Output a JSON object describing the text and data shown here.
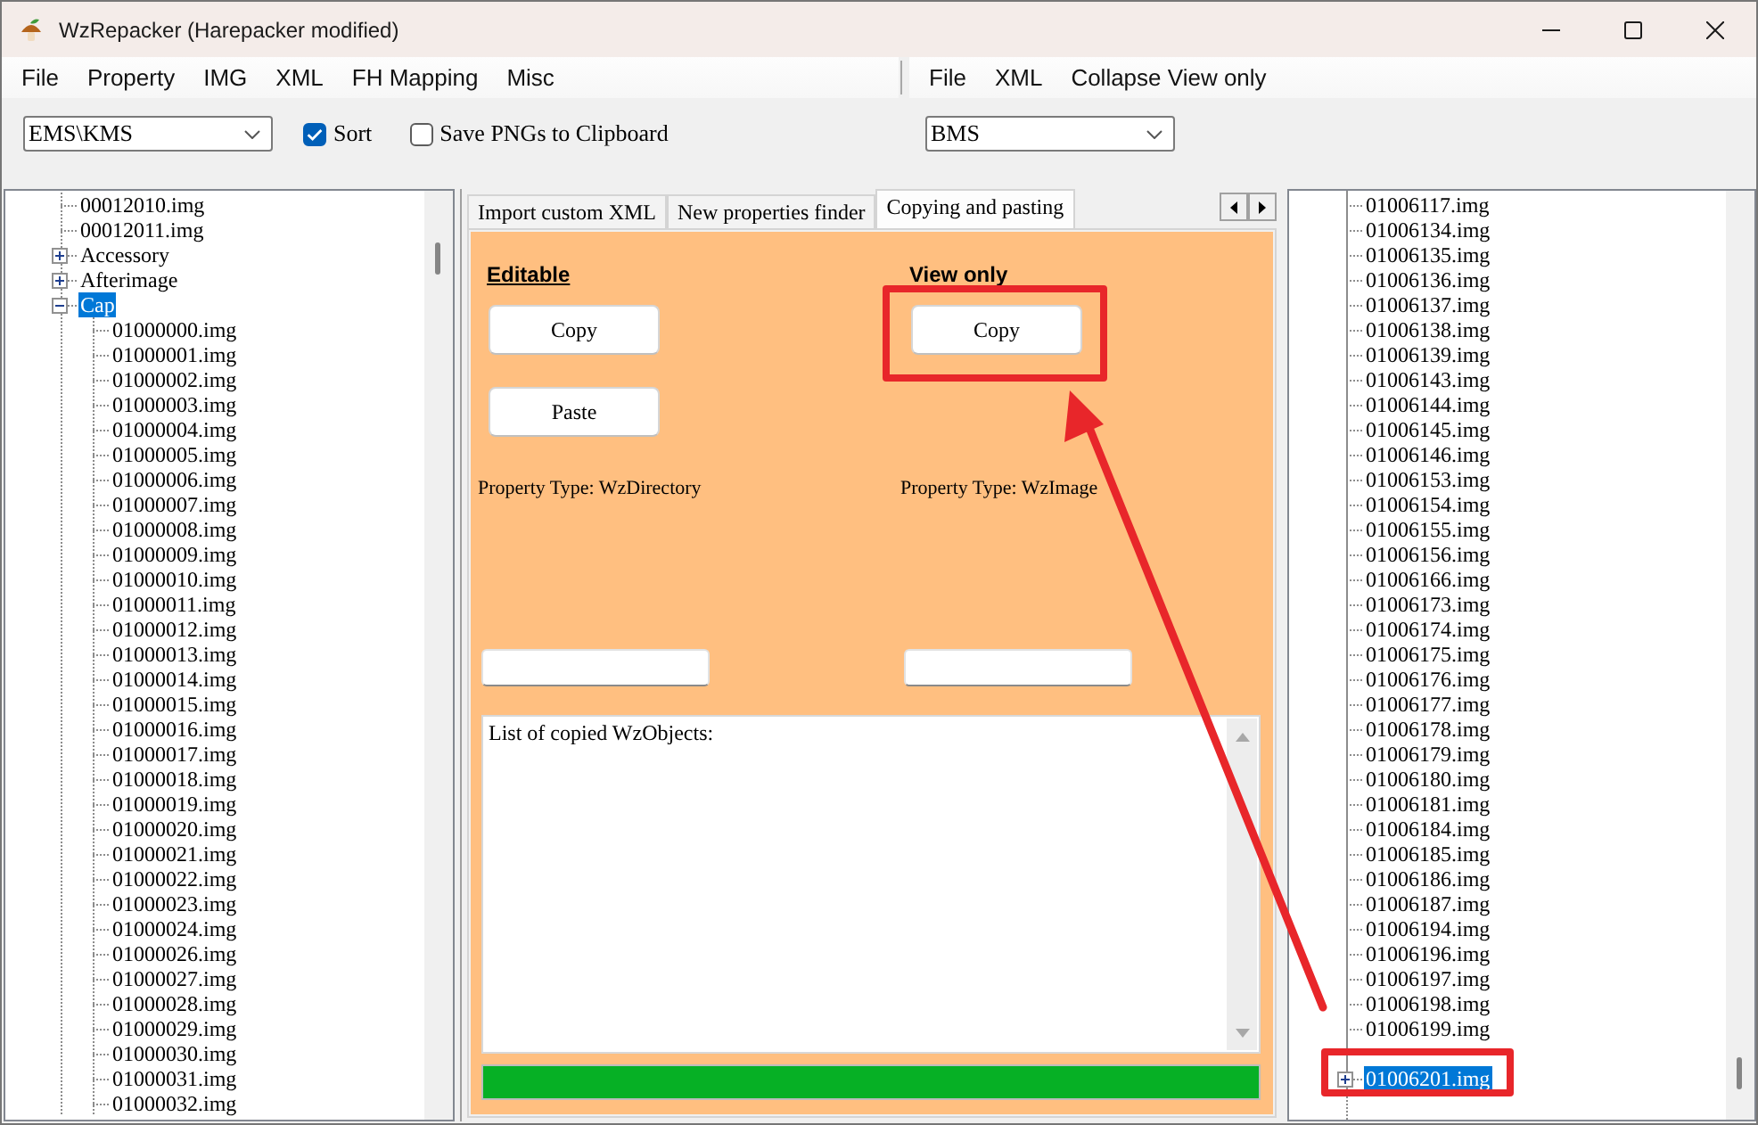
{
  "window": {
    "title": "WzRepacker (Harepacker modified)"
  },
  "menu_left": [
    "File",
    "Property",
    "IMG",
    "XML",
    "FH Mapping",
    "Misc"
  ],
  "menu_right": [
    "File",
    "XML",
    "Collapse View only"
  ],
  "toolbar_left": {
    "version_select": "EMS\\KMS",
    "checkboxes": [
      {
        "label": "Sort",
        "checked": true
      },
      {
        "label": "Save PNGs to Clipboard",
        "checked": false
      }
    ]
  },
  "toolbar_right": {
    "version_select": "BMS"
  },
  "left_tree": {
    "items": [
      {
        "label": "00012010.img",
        "kind": "leaf",
        "selected": false
      },
      {
        "label": "00012011.img",
        "kind": "leaf",
        "selected": false
      },
      {
        "label": "Accessory",
        "kind": "branch",
        "expanded": false,
        "selected": false
      },
      {
        "label": "Afterimage",
        "kind": "branch",
        "expanded": false,
        "selected": false
      },
      {
        "label": "Cap",
        "kind": "branch",
        "expanded": true,
        "selected": true,
        "children": [
          {
            "label": "01000000.img",
            "kind": "leaf",
            "selected": false
          },
          {
            "label": "01000001.img",
            "kind": "leaf",
            "selected": false
          },
          {
            "label": "01000002.img",
            "kind": "leaf",
            "selected": false
          },
          {
            "label": "01000003.img",
            "kind": "leaf",
            "selected": false
          },
          {
            "label": "01000004.img",
            "kind": "leaf",
            "selected": false
          },
          {
            "label": "01000005.img",
            "kind": "leaf",
            "selected": false
          },
          {
            "label": "01000006.img",
            "kind": "leaf",
            "selected": false
          },
          {
            "label": "01000007.img",
            "kind": "leaf",
            "selected": false
          },
          {
            "label": "01000008.img",
            "kind": "leaf",
            "selected": false
          },
          {
            "label": "01000009.img",
            "kind": "leaf",
            "selected": false
          },
          {
            "label": "01000010.img",
            "kind": "leaf",
            "selected": false
          },
          {
            "label": "01000011.img",
            "kind": "leaf",
            "selected": false
          },
          {
            "label": "01000012.img",
            "kind": "leaf",
            "selected": false
          },
          {
            "label": "01000013.img",
            "kind": "leaf",
            "selected": false
          },
          {
            "label": "01000014.img",
            "kind": "leaf",
            "selected": false
          },
          {
            "label": "01000015.img",
            "kind": "leaf",
            "selected": false
          },
          {
            "label": "01000016.img",
            "kind": "leaf",
            "selected": false
          },
          {
            "label": "01000017.img",
            "kind": "leaf",
            "selected": false
          },
          {
            "label": "01000018.img",
            "kind": "leaf",
            "selected": false
          },
          {
            "label": "01000019.img",
            "kind": "leaf",
            "selected": false
          },
          {
            "label": "01000020.img",
            "kind": "leaf",
            "selected": false
          },
          {
            "label": "01000021.img",
            "kind": "leaf",
            "selected": false
          },
          {
            "label": "01000022.img",
            "kind": "leaf",
            "selected": false
          },
          {
            "label": "01000023.img",
            "kind": "leaf",
            "selected": false
          },
          {
            "label": "01000024.img",
            "kind": "leaf",
            "selected": false
          },
          {
            "label": "01000026.img",
            "kind": "leaf",
            "selected": false
          },
          {
            "label": "01000027.img",
            "kind": "leaf",
            "selected": false
          },
          {
            "label": "01000028.img",
            "kind": "leaf",
            "selected": false
          },
          {
            "label": "01000029.img",
            "kind": "leaf",
            "selected": false
          },
          {
            "label": "01000030.img",
            "kind": "leaf",
            "selected": false
          },
          {
            "label": "01000031.img",
            "kind": "leaf",
            "selected": false
          },
          {
            "label": "01000032.img",
            "kind": "leaf",
            "selected": false
          }
        ]
      }
    ]
  },
  "tabs": [
    {
      "label": "Import custom XML",
      "selected": false
    },
    {
      "label": "New properties finder",
      "selected": false
    },
    {
      "label": "Copying and pasting",
      "selected": true
    }
  ],
  "copy_paste": {
    "columns": [
      {
        "heading": "Editable",
        "underlined": true,
        "buttons": [
          {
            "label": "Copy",
            "highlighted": false
          },
          {
            "label": "Paste",
            "highlighted": false
          }
        ],
        "property_type": "Property Type: WzDirectory"
      },
      {
        "heading": "View only",
        "underlined": false,
        "buttons": [
          {
            "label": "Copy",
            "highlighted": true
          }
        ],
        "property_type": "Property Type: WzImage"
      }
    ],
    "copied_list": {
      "value": "List of copied WzObjects:"
    },
    "progress": {
      "level": 1
    }
  },
  "right_tree": {
    "items": [
      {
        "label": "01006117.img",
        "kind": "leaf",
        "selected": false,
        "highlighted": false
      },
      {
        "label": "01006134.img",
        "kind": "leaf",
        "selected": false,
        "highlighted": false
      },
      {
        "label": "01006135.img",
        "kind": "leaf",
        "selected": false,
        "highlighted": false
      },
      {
        "label": "01006136.img",
        "kind": "leaf",
        "selected": false,
        "highlighted": false
      },
      {
        "label": "01006137.img",
        "kind": "leaf",
        "selected": false,
        "highlighted": false
      },
      {
        "label": "01006138.img",
        "kind": "leaf",
        "selected": false,
        "highlighted": false
      },
      {
        "label": "01006139.img",
        "kind": "leaf",
        "selected": false,
        "highlighted": false
      },
      {
        "label": "01006143.img",
        "kind": "leaf",
        "selected": false,
        "highlighted": false
      },
      {
        "label": "01006144.img",
        "kind": "leaf",
        "selected": false,
        "highlighted": false
      },
      {
        "label": "01006145.img",
        "kind": "leaf",
        "selected": false,
        "highlighted": false
      },
      {
        "label": "01006146.img",
        "kind": "leaf",
        "selected": false,
        "highlighted": false
      },
      {
        "label": "01006153.img",
        "kind": "leaf",
        "selected": false,
        "highlighted": false
      },
      {
        "label": "01006154.img",
        "kind": "leaf",
        "selected": false,
        "highlighted": false
      },
      {
        "label": "01006155.img",
        "kind": "leaf",
        "selected": false,
        "highlighted": false
      },
      {
        "label": "01006156.img",
        "kind": "leaf",
        "selected": false,
        "highlighted": false
      },
      {
        "label": "01006166.img",
        "kind": "leaf",
        "selected": false,
        "highlighted": false
      },
      {
        "label": "01006173.img",
        "kind": "leaf",
        "selected": false,
        "highlighted": false
      },
      {
        "label": "01006174.img",
        "kind": "leaf",
        "selected": false,
        "highlighted": false
      },
      {
        "label": "01006175.img",
        "kind": "leaf",
        "selected": false,
        "highlighted": false
      },
      {
        "label": "01006176.img",
        "kind": "leaf",
        "selected": false,
        "highlighted": false
      },
      {
        "label": "01006177.img",
        "kind": "leaf",
        "selected": false,
        "highlighted": false
      },
      {
        "label": "01006178.img",
        "kind": "leaf",
        "selected": false,
        "highlighted": false
      },
      {
        "label": "01006179.img",
        "kind": "leaf",
        "selected": false,
        "highlighted": false
      },
      {
        "label": "01006180.img",
        "kind": "leaf",
        "selected": false,
        "highlighted": false
      },
      {
        "label": "01006181.img",
        "kind": "leaf",
        "selected": false,
        "highlighted": false
      },
      {
        "label": "01006184.img",
        "kind": "leaf",
        "selected": false,
        "highlighted": false
      },
      {
        "label": "01006185.img",
        "kind": "leaf",
        "selected": false,
        "highlighted": false
      },
      {
        "label": "01006186.img",
        "kind": "leaf",
        "selected": false,
        "highlighted": false
      },
      {
        "label": "01006187.img",
        "kind": "leaf",
        "selected": false,
        "highlighted": false
      },
      {
        "label": "01006194.img",
        "kind": "leaf",
        "selected": false,
        "highlighted": false
      },
      {
        "label": "01006196.img",
        "kind": "leaf",
        "selected": false,
        "highlighted": false
      },
      {
        "label": "01006197.img",
        "kind": "leaf",
        "selected": false,
        "highlighted": false
      },
      {
        "label": "01006198.img",
        "kind": "leaf",
        "selected": false,
        "highlighted": false
      },
      {
        "label": "01006199.img",
        "kind": "leaf",
        "selected": false,
        "highlighted": false
      },
      {
        "kind": "leaf"
      },
      {
        "label": "01006201.img",
        "kind": "branch",
        "expanded": false,
        "selected": true,
        "highlighted": true
      }
    ]
  }
}
